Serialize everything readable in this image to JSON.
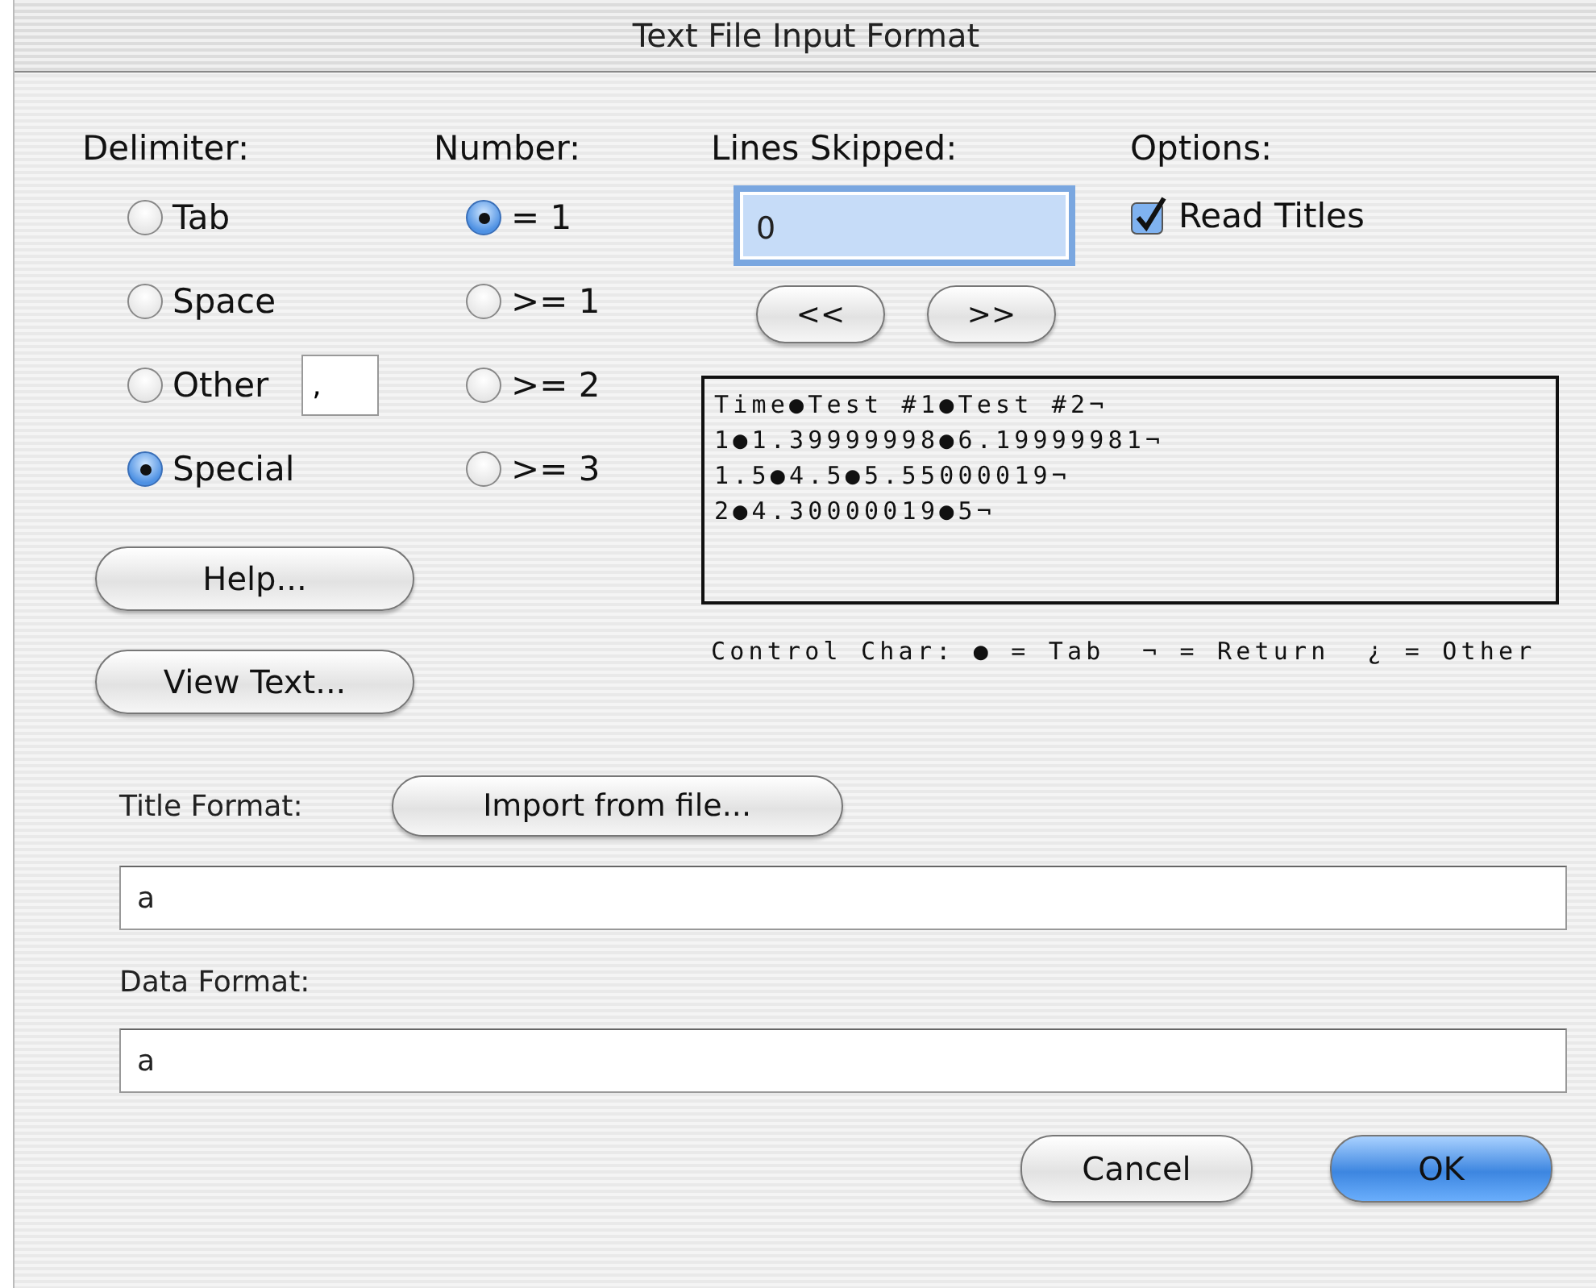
{
  "window": {
    "title": "Text File Input Format"
  },
  "delimiter": {
    "label": "Delimiter:",
    "options": [
      {
        "label": "Tab",
        "selected": false
      },
      {
        "label": "Space",
        "selected": false
      },
      {
        "label": "Other",
        "selected": false,
        "field_value": ","
      },
      {
        "label": "Special",
        "selected": true
      }
    ]
  },
  "number": {
    "label": "Number:",
    "options": [
      {
        "label": "= 1",
        "selected": true
      },
      {
        "label": ">= 1",
        "selected": false
      },
      {
        "label": ">= 2",
        "selected": false
      },
      {
        "label": ">= 3",
        "selected": false
      }
    ]
  },
  "lines_skipped": {
    "label": "Lines Skipped:",
    "value": "0",
    "buttons": [
      "<<",
      ">>"
    ]
  },
  "options": {
    "label": "Options:",
    "items": [
      {
        "label": "Read Titles",
        "checked": true
      }
    ]
  },
  "preview": {
    "lines": [
      "Time●Test #1●Test #2¬",
      "1●1.39999998●6.19999981¬",
      "1.5●4.5●5.55000019¬",
      "2●4.30000019●5¬"
    ],
    "legend": "Control Char: ● = Tab  ¬ = Return  ¿ = Other"
  },
  "left_buttons": [
    "Help...",
    "View Text..."
  ],
  "title_format": {
    "label": "Title Format:",
    "button": "Import from file...",
    "value": "a"
  },
  "data_format": {
    "label": "Data Format:",
    "value": "a"
  },
  "buttons": [
    {
      "label": "Cancel",
      "kind": "normal"
    },
    {
      "label": "OK",
      "kind": "default"
    }
  ]
}
